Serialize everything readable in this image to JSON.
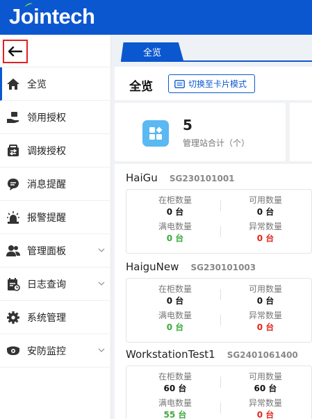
{
  "app": {
    "logo_text": "Jointech"
  },
  "colors": {
    "brand": "#0b57d0",
    "ok": "#3caa3c",
    "alert": "#e0281d",
    "summary_icon_bg": "#5ab8f2"
  },
  "sidebar": {
    "back_icon": "arrow-left-icon",
    "items": [
      {
        "label": "全览",
        "icon": "home-icon",
        "active": true,
        "expandable": false
      },
      {
        "label": "领用授权",
        "icon": "hand-receive-icon",
        "active": false,
        "expandable": false
      },
      {
        "label": "调拨授权",
        "icon": "transfer-icon",
        "active": false,
        "expandable": false
      },
      {
        "label": "消息提醒",
        "icon": "message-icon",
        "active": false,
        "expandable": false
      },
      {
        "label": "报警提醒",
        "icon": "alarm-icon",
        "active": false,
        "expandable": false
      },
      {
        "label": "管理面板",
        "icon": "users-icon",
        "active": false,
        "expandable": true
      },
      {
        "label": "日志查询",
        "icon": "log-icon",
        "active": false,
        "expandable": true
      },
      {
        "label": "系统管理",
        "icon": "gear-icon",
        "active": false,
        "expandable": false
      },
      {
        "label": "安防监控",
        "icon": "camera-icon",
        "active": false,
        "expandable": true
      }
    ]
  },
  "tabs": [
    {
      "label": "全览",
      "active": true
    }
  ],
  "main": {
    "title": "全览",
    "switch_button": "切换至卡片模式",
    "summary": {
      "value": "5",
      "label": "管理站合计（个）"
    }
  },
  "stations": [
    {
      "name": "HaiGu",
      "code": "SG230101001",
      "in_cabinet_label": "在柜数量",
      "in_cabinet": "0 台",
      "available_label": "可用数量",
      "available": "0 台",
      "full_charge_label": "满电数量",
      "full_charge": "0 台",
      "abnormal_label": "异常数量",
      "abnormal": "0 台"
    },
    {
      "name": "HaiguNew",
      "code": "SG230101003",
      "in_cabinet_label": "在柜数量",
      "in_cabinet": "0 台",
      "available_label": "可用数量",
      "available": "0 台",
      "full_charge_label": "满电数量",
      "full_charge": "0 台",
      "abnormal_label": "异常数量",
      "abnormal": "0 台"
    },
    {
      "name": "WorkstationTest1",
      "code": "SG2401061400",
      "in_cabinet_label": "在柜数量",
      "in_cabinet": "60 台",
      "available_label": "可用数量",
      "available": "60 台",
      "full_charge_label": "满电数量",
      "full_charge": "55 台",
      "abnormal_label": "异常数量",
      "abnormal": "0 台"
    }
  ]
}
